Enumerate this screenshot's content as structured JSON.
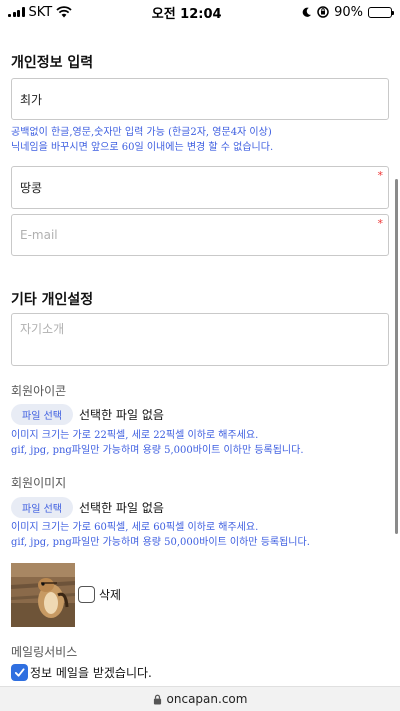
{
  "status_bar": {
    "carrier": "SKT",
    "time": "오전 12:04",
    "battery": "90%"
  },
  "section_personal": {
    "title": "개인정보 입력",
    "name_value": "최가",
    "name_help_line1": "공백없이 한글,영문,숫자만 입력 가능 (한글2자, 영문4자 이상)",
    "name_help_line2": "닉네임을 바꾸시면 앞으로 60일 이내에는 변경 할 수 없습니다.",
    "nickname_value": "땅콩",
    "required_mark": "*",
    "email_placeholder": "E-mail"
  },
  "section_etc": {
    "title": "기타 개인설정",
    "intro_placeholder": "자기소개",
    "icon_label": "회원아이콘",
    "icon_file_button": "파일 선택",
    "icon_file_status": "선택한 파일 없음",
    "icon_help_line1": "이미지 크기는 가로 22픽셀, 세로 22픽셀 이하로 해주세요.",
    "icon_help_line2": "gif, jpg, png파일만 가능하며 용량 5,000바이트 이하만 등록됩니다.",
    "image_label": "회원이미지",
    "image_file_button": "파일 선택",
    "image_file_status": "선택한 파일 없음",
    "image_help_line1": "이미지 크기는 가로 60픽셀, 세로 60픽셀 이하로 해주세요.",
    "image_help_line2": "gif, jpg, png파일만 가능하며 용량 50,000바이트 이하만 등록됩니다.",
    "delete_label": "삭제",
    "mailing_label": "메일링서비스",
    "mailing_checkbox_label": "정보 메일을 받겠습니다.",
    "mailing_checked": true
  },
  "url_bar": {
    "domain": "oncapan.com"
  },
  "colors": {
    "help_text": "#3d5ee0",
    "required": "#e33333",
    "checkbox": "#2f6fe0"
  }
}
